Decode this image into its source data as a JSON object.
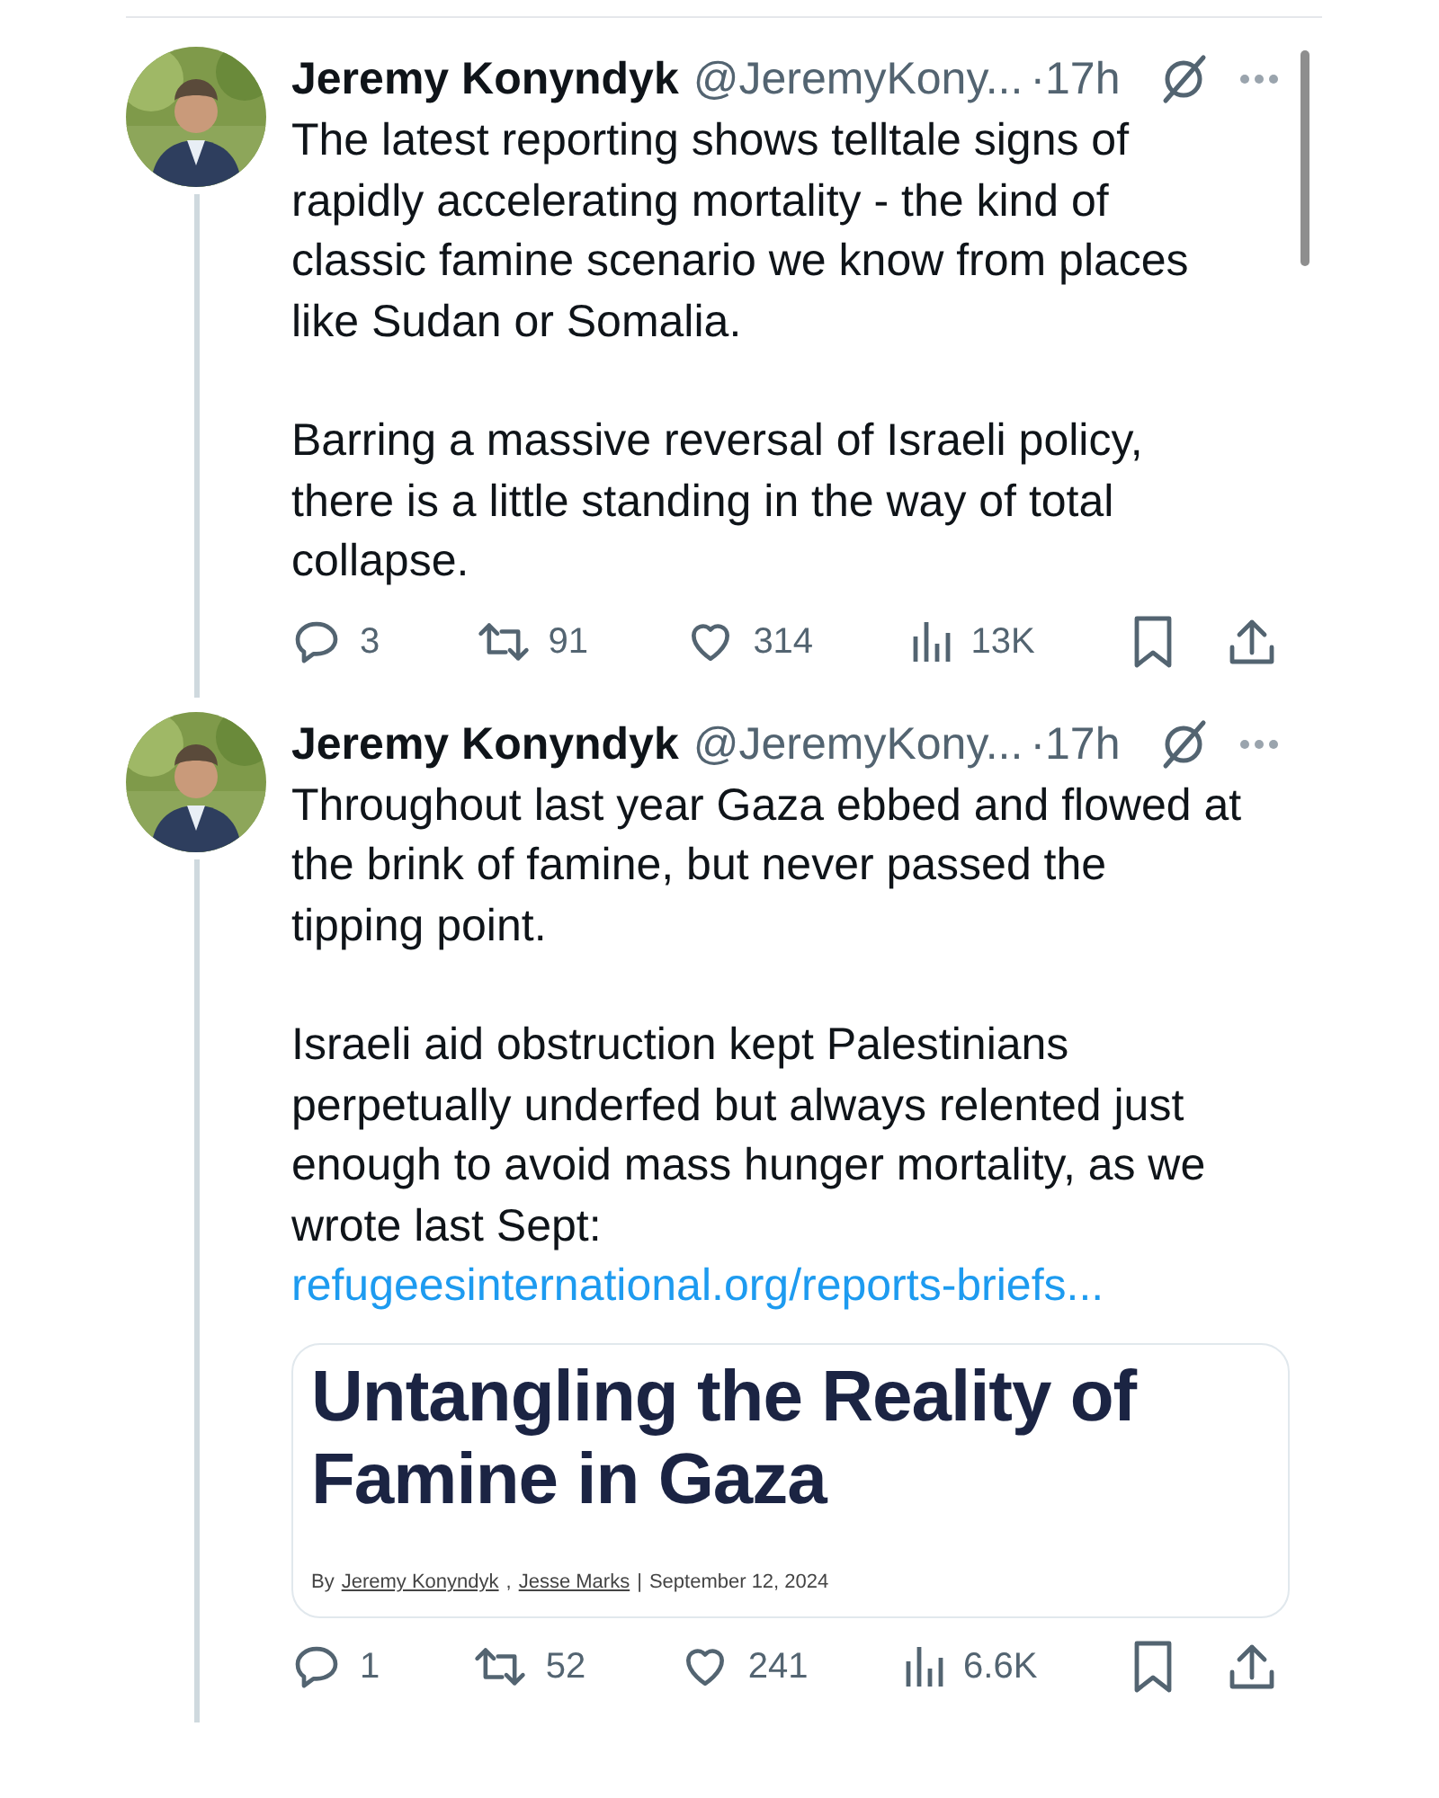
{
  "tweets": [
    {
      "name": "Jeremy Konyndyk",
      "handle": "@JeremyKony...",
      "separator": "·",
      "time": "17h",
      "paragraphs": [
        "The latest reporting shows telltale signs of rapidly accelerating mortality - the kind of classic famine scenario we know from places like Sudan or Somalia.",
        "Barring a massive reversal of Israeli policy, there is a little standing in the way of total collapse."
      ],
      "actions": {
        "replies": "3",
        "reposts": "91",
        "likes": "314",
        "views": "13K"
      }
    },
    {
      "name": "Jeremy Konyndyk",
      "handle": "@JeremyKony...",
      "separator": "·",
      "time": "17h",
      "paragraphs": [
        "Throughout last year Gaza ebbed and flowed at the brink of famine, but never passed the tipping point.",
        "Israeli aid obstruction kept Palestinians perpetually underfed but always relented just enough to avoid mass hunger mortality, as we wrote last Sept:"
      ],
      "link": "refugeesinternational.org/reports-briefs...",
      "card": {
        "title": "Untangling the Reality of Famine in Gaza",
        "by": "By",
        "authors": [
          "Jeremy Konyndyk",
          "Jesse Marks"
        ],
        "author_separator": ",",
        "date_separator": "|",
        "date": "September 12, 2024"
      },
      "actions": {
        "replies": "1",
        "reposts": "52",
        "likes": "241",
        "views": "6.6K"
      }
    }
  ]
}
